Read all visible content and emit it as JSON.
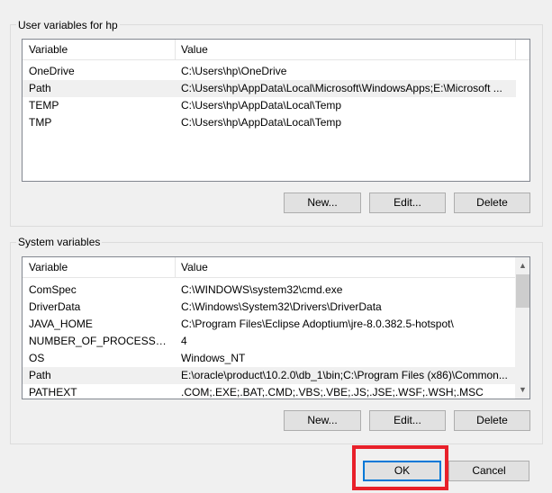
{
  "user_group": {
    "label": "User variables for hp",
    "columns": [
      "Variable",
      "Value"
    ],
    "rows": [
      {
        "variable": "OneDrive",
        "value": "C:\\Users\\hp\\OneDrive"
      },
      {
        "variable": "Path",
        "value": "C:\\Users\\hp\\AppData\\Local\\Microsoft\\WindowsApps;E:\\Microsoft ..."
      },
      {
        "variable": "TEMP",
        "value": "C:\\Users\\hp\\AppData\\Local\\Temp"
      },
      {
        "variable": "TMP",
        "value": "C:\\Users\\hp\\AppData\\Local\\Temp"
      }
    ],
    "buttons": {
      "new": "New...",
      "edit": "Edit...",
      "delete": "Delete"
    }
  },
  "system_group": {
    "label": "System variables",
    "columns": [
      "Variable",
      "Value"
    ],
    "rows": [
      {
        "variable": "ComSpec",
        "value": "C:\\WINDOWS\\system32\\cmd.exe"
      },
      {
        "variable": "DriverData",
        "value": "C:\\Windows\\System32\\Drivers\\DriverData"
      },
      {
        "variable": "JAVA_HOME",
        "value": "C:\\Program Files\\Eclipse Adoptium\\jre-8.0.382.5-hotspot\\"
      },
      {
        "variable": "NUMBER_OF_PROCESSORS",
        "value": "4"
      },
      {
        "variable": "OS",
        "value": "Windows_NT"
      },
      {
        "variable": "Path",
        "value": "E:\\oracle\\product\\10.2.0\\db_1\\bin;C:\\Program Files (x86)\\Common..."
      },
      {
        "variable": "PATHEXT",
        "value": ".COM;.EXE;.BAT;.CMD;.VBS;.VBE;.JS;.JSE;.WSF;.WSH;.MSC"
      }
    ],
    "buttons": {
      "new": "New...",
      "edit": "Edit...",
      "delete": "Delete"
    }
  },
  "dialog_buttons": {
    "ok": "OK",
    "cancel": "Cancel"
  },
  "colors": {
    "highlight": "#e8202a",
    "selected_row": "#f0f0f0"
  }
}
